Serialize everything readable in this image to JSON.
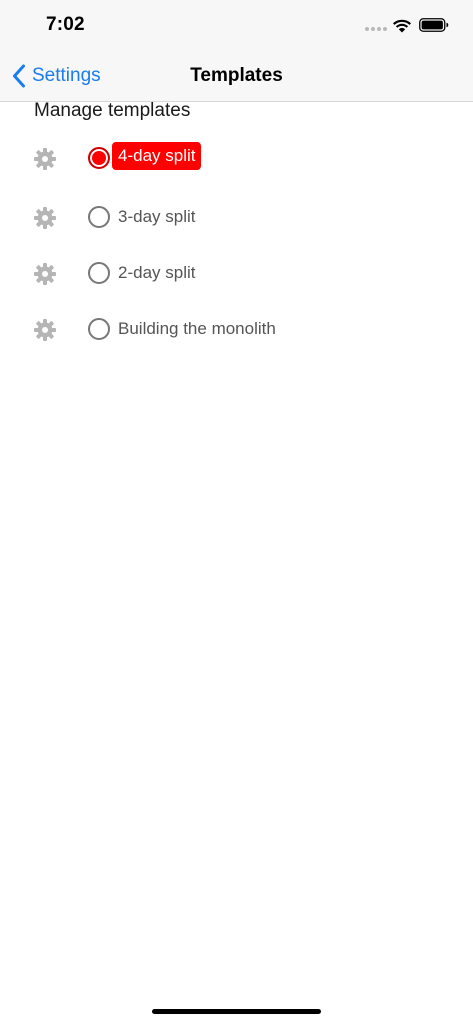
{
  "status_bar": {
    "time": "7:02",
    "icons": [
      "signal-dots-icon",
      "wifi-icon",
      "battery-icon"
    ]
  },
  "nav": {
    "back_label": "Settings",
    "title": "Templates"
  },
  "section": {
    "title": "Manage templates"
  },
  "templates": [
    {
      "label": "4-day split",
      "selected": true
    },
    {
      "label": "3-day split",
      "selected": false
    },
    {
      "label": "2-day split",
      "selected": false
    },
    {
      "label": "Building the monolith",
      "selected": false
    }
  ],
  "colors": {
    "accent": "#1a7cf0",
    "selected": "#ff0000",
    "gear": "#b5b5b5"
  }
}
